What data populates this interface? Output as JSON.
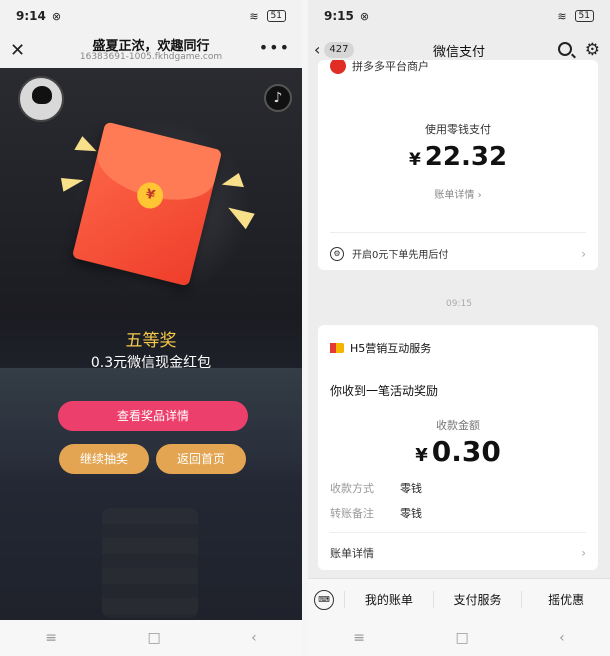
{
  "left": {
    "status": {
      "time": "9:14",
      "mute": "⊗",
      "wifi": "≋",
      "battery": "51"
    },
    "header": {
      "close": "✕",
      "title": "盛夏正浓，欢趣同行",
      "url": "16383691-1005.fkhdgame.com",
      "more": "•••"
    },
    "sound_icon": "♪",
    "seal": "¥",
    "prize": {
      "level": "五等奖",
      "description": "0.3元微信现金红包"
    },
    "buttons": {
      "view_prize": "查看奖品详情",
      "continue": "继续抽奖",
      "home": "返回首页"
    },
    "nav": {
      "menu": "≡",
      "home": "□",
      "back": "‹"
    }
  },
  "right": {
    "status": {
      "time": "9:15",
      "mute": "⊗",
      "wifi": "≋",
      "battery": "51"
    },
    "header": {
      "back": "‹",
      "badge": "427",
      "title": "微信支付",
      "gear": "⚙"
    },
    "card1": {
      "merchant": "拼多多平台商户",
      "pay_label": "使用零钱支付",
      "currency": "¥",
      "amount": "22.32",
      "detail_link": "账单详情 ›",
      "credit_icon": "⚙",
      "credit_text": "开启0元下单先用后付",
      "arrow": "›"
    },
    "timestamp": "09:15",
    "card2": {
      "service": "H5营销互动服务",
      "received": "你收到一笔活动奖励",
      "amount_label": "收款金额",
      "currency": "¥",
      "amount": "0.30",
      "method_key": "收款方式",
      "method_value": "零钱",
      "note_key": "转账备注",
      "note_value": "零钱",
      "detail": "账单详情",
      "arrow": "›"
    },
    "menu": {
      "keyboard": "⌨",
      "items": [
        "我的账单",
        "支付服务",
        "摇优惠"
      ]
    },
    "nav": {
      "menu": "≡",
      "home": "□",
      "back": "‹"
    }
  }
}
